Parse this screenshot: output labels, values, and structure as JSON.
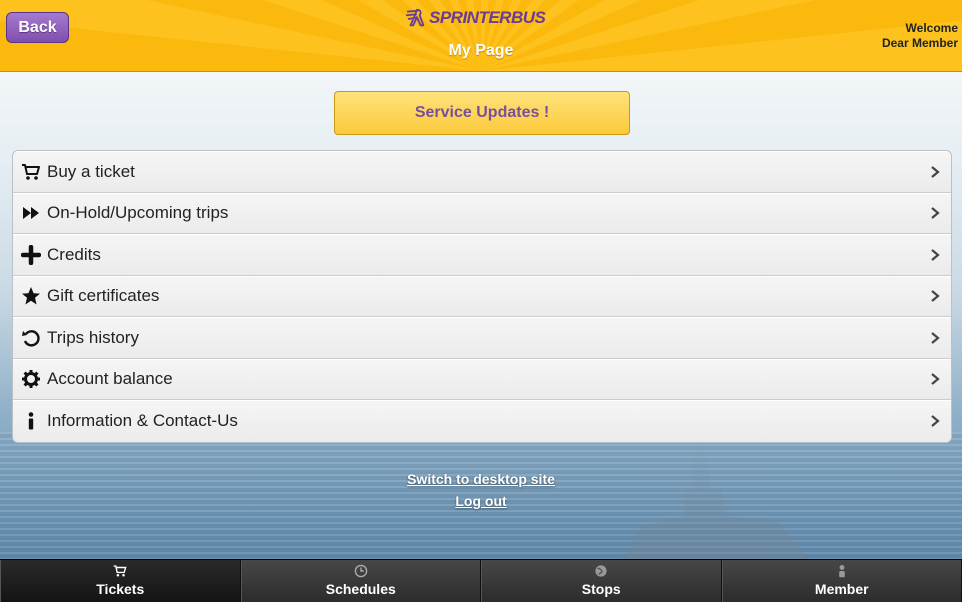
{
  "header": {
    "back_label": "Back",
    "logo_text": "SPRINTERBUS",
    "page_title": "My Page",
    "welcome_line1": "Welcome",
    "welcome_line2": "Dear Member",
    "bg_color": "#fdc21e",
    "logo_color": "#6a3c97"
  },
  "service_updates": {
    "label": "Service Updates !"
  },
  "menu": {
    "items": [
      {
        "label": "Buy a ticket",
        "icon": "cart-icon"
      },
      {
        "label": "On-Hold/Upcoming trips",
        "icon": "fast-forward-icon"
      },
      {
        "label": "Credits",
        "icon": "plus-icon"
      },
      {
        "label": "Gift certificates",
        "icon": "star-icon"
      },
      {
        "label": "Trips history",
        "icon": "history-icon"
      },
      {
        "label": "Account balance",
        "icon": "gear-icon"
      },
      {
        "label": "Information & Contact-Us",
        "icon": "info-icon"
      }
    ]
  },
  "links": {
    "desktop": "Switch to desktop site",
    "logout": "Log out"
  },
  "tabs": [
    {
      "label": "Tickets",
      "icon": "cart-icon",
      "active": true
    },
    {
      "label": "Schedules",
      "icon": "clock-icon",
      "active": false
    },
    {
      "label": "Stops",
      "icon": "globe-icon",
      "active": false
    },
    {
      "label": "Member",
      "icon": "person-icon",
      "active": false
    }
  ]
}
